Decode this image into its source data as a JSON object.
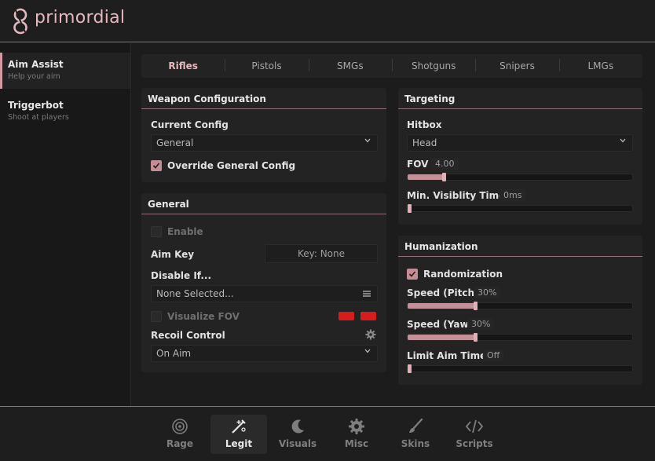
{
  "brand": {
    "name": "primordial",
    "accent": "#d49aa4"
  },
  "sidebar": {
    "items": [
      {
        "title": "Aim Assist",
        "subtitle": "Help your aim"
      },
      {
        "title": "Triggerbot",
        "subtitle": "Shoot at players"
      }
    ]
  },
  "tabs": [
    "Rifles",
    "Pistols",
    "SMGs",
    "Shotguns",
    "Snipers",
    "LMGs"
  ],
  "weapon_config": {
    "title": "Weapon Configuration",
    "current_config_label": "Current Config",
    "current_config_value": "General",
    "override_label": "Override General Config"
  },
  "general": {
    "title": "General",
    "enable_label": "Enable",
    "aim_key_label": "Aim Key",
    "aim_key_value": "Key: None",
    "disable_if_label": "Disable If...",
    "disable_if_value": "None Selected...",
    "visualize_fov_label": "Visualize FOV",
    "fov_colors": [
      "#d71c1c",
      "#d71c1c"
    ],
    "recoil_control_label": "Recoil Control",
    "recoil_control_value": "On Aim"
  },
  "targeting": {
    "title": "Targeting",
    "hitbox_label": "Hitbox",
    "hitbox_value": "Head",
    "fov_label": "FOV",
    "fov_value": "4.00",
    "fov_fraction": 0.16,
    "min_vis_label": "Min. Visiblity Time",
    "min_vis_value": "0ms",
    "min_vis_fraction": 0
  },
  "humanization": {
    "title": "Humanization",
    "randomization_label": "Randomization",
    "pitch_label": "Speed (Pitch)",
    "pitch_value": "30%",
    "pitch_fraction": 0.3,
    "yaw_label": "Speed (Yaw)",
    "yaw_value": "30%",
    "yaw_fraction": 0.3,
    "limit_label": "Limit Aim Time",
    "limit_value": "Off",
    "limit_fraction": 0
  },
  "bottom_nav": [
    {
      "label": "Rage",
      "icon": "target-icon"
    },
    {
      "label": "Legit",
      "icon": "crosshair-pen-icon"
    },
    {
      "label": "Visuals",
      "icon": "moon-icon"
    },
    {
      "label": "Misc",
      "icon": "gear-icon"
    },
    {
      "label": "Skins",
      "icon": "brush-icon"
    },
    {
      "label": "Scripts",
      "icon": "code-icon"
    }
  ]
}
